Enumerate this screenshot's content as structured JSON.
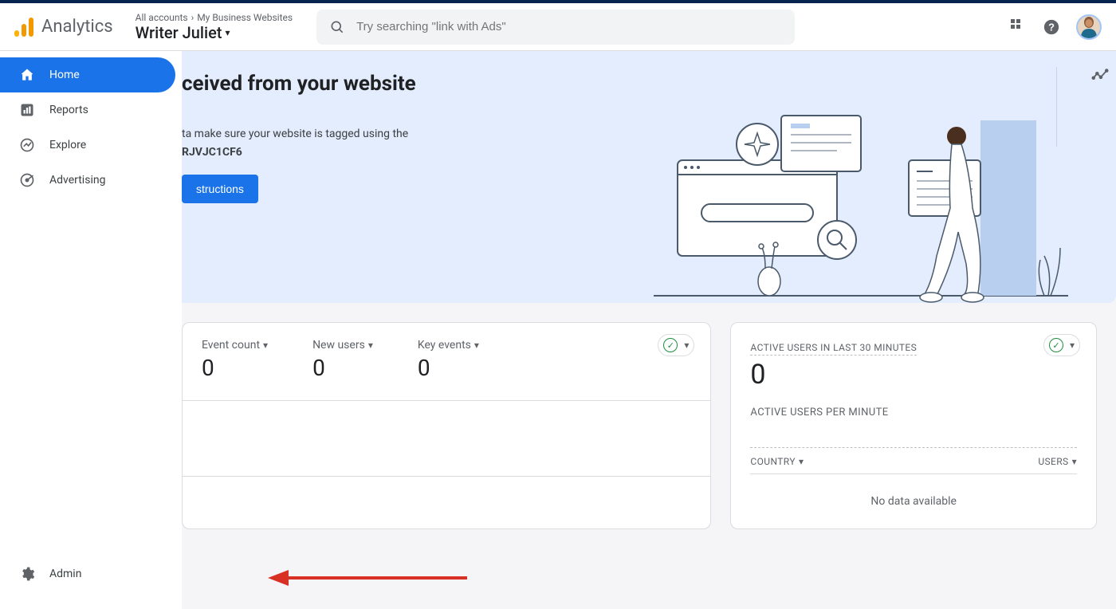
{
  "header": {
    "app_name": "Analytics",
    "breadcrumb": {
      "level1": "All accounts",
      "level2": "My Business Websites"
    },
    "property": "Writer Juliet",
    "search_placeholder": "Try searching \"link with Ads\""
  },
  "sidebar": {
    "items": [
      {
        "label": "Home",
        "active": true
      },
      {
        "label": "Reports",
        "active": false
      },
      {
        "label": "Explore",
        "active": false
      },
      {
        "label": "Advertising",
        "active": false
      }
    ],
    "admin_label": "Admin"
  },
  "banner": {
    "title_fragment": "ceived from your website",
    "desc_prefix": "ta make sure your website is tagged using the",
    "tag_id": "RJVJC1CF6",
    "button_label": "structions"
  },
  "metrics_card": {
    "headers": [
      "Event count",
      "New users",
      "Key events"
    ],
    "values": [
      "0",
      "0",
      "0"
    ]
  },
  "realtime_card": {
    "title": "ACTIVE USERS IN LAST 30 MINUTES",
    "value": "0",
    "subtitle": "ACTIVE USERS PER MINUTE",
    "col1": "COUNTRY",
    "col2": "USERS",
    "no_data": "No data available"
  }
}
